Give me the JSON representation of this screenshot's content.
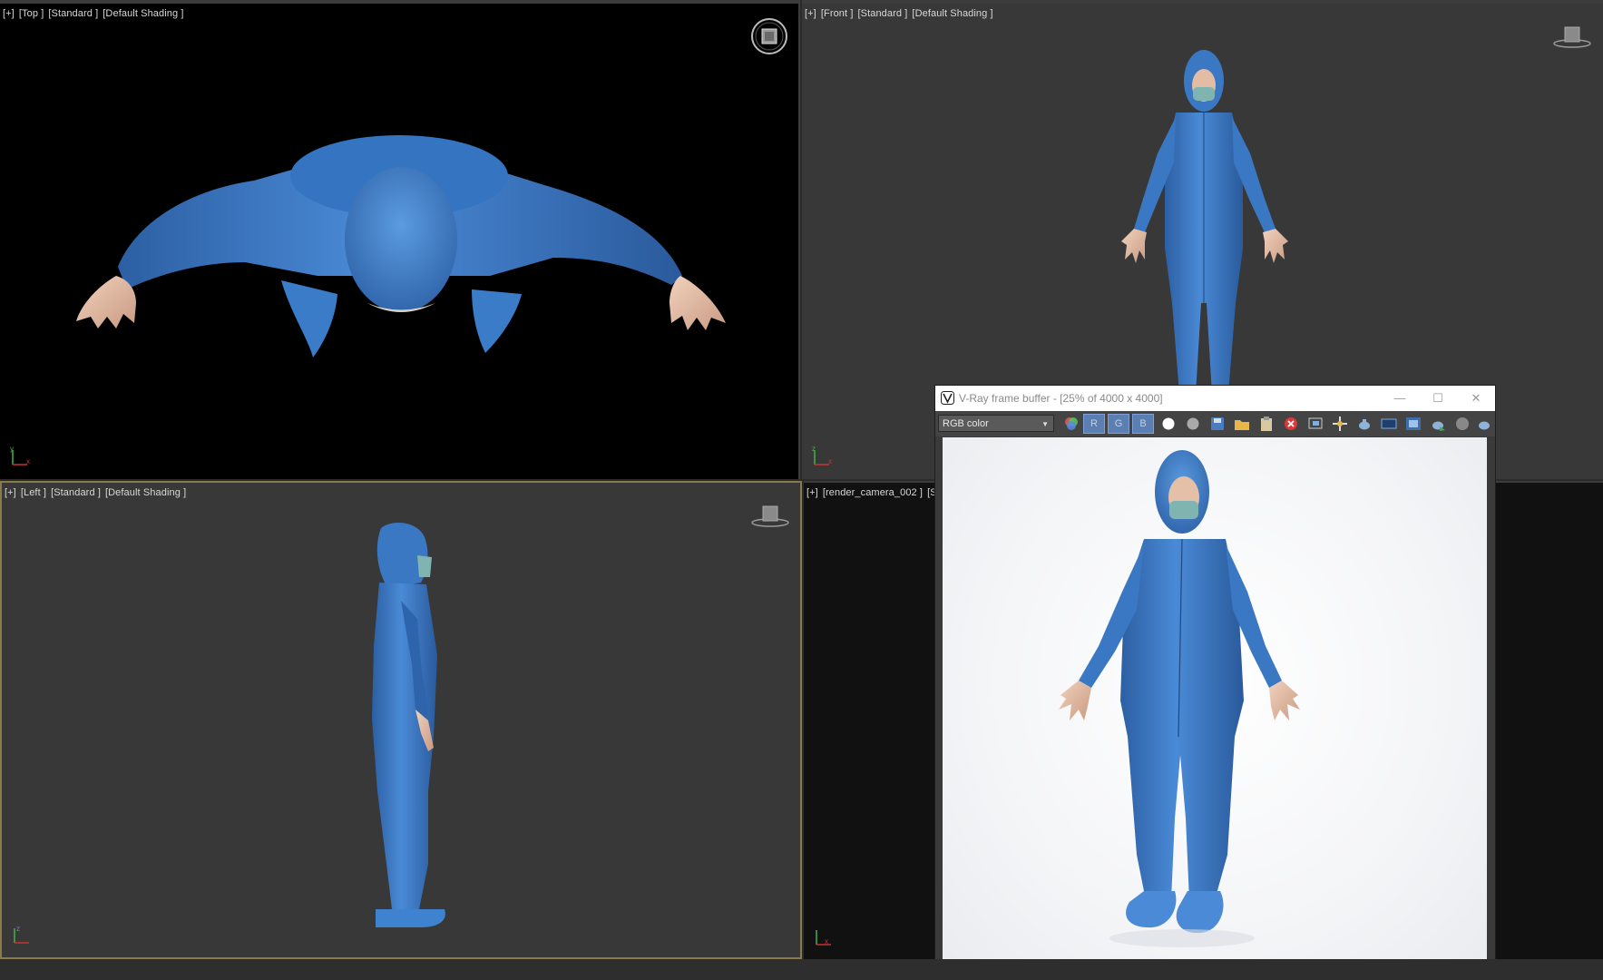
{
  "viewports": {
    "top": {
      "label": [
        "[+]",
        "[Top ]",
        "[Standard ]",
        "[Default Shading ]"
      ]
    },
    "front": {
      "label": [
        "[+]",
        "[Front ]",
        "[Standard ]",
        "[Default Shading ]"
      ]
    },
    "left": {
      "label": [
        "[+]",
        "[Left ]",
        "[Standard ]",
        "[Default Shading ]"
      ]
    },
    "camera": {
      "label": [
        "[+]",
        "[render_camera_002 ]",
        "[Sta"
      ]
    }
  },
  "axis_labels": {
    "x": "x",
    "y": "y",
    "z": "z"
  },
  "vfb": {
    "title": "V-Ray frame buffer - [25% of 4000 x 4000]",
    "window_buttons": {
      "minimize": "—",
      "maximize": "☐",
      "close": "✕"
    },
    "channel": "RGB color",
    "channel_buttons": {
      "r": "R",
      "g": "G",
      "b": "B"
    },
    "toolbar_icons": [
      "color-correct-icon",
      "white-circle-icon",
      "grey-circle-icon",
      "save-icon",
      "open-folder-icon",
      "clipboard-icon",
      "clear-icon",
      "region-render-icon",
      "track-mouse-icon",
      "teapot-icon",
      "pixel-info-icon",
      "lens-effects-icon",
      "render-icon",
      "stop-icon",
      "teapot-interactive-icon"
    ]
  },
  "colors": {
    "suit_blue": "#3f7dc9",
    "viewport_bg": "#383838",
    "top_viewport_bg": "#000000",
    "camera_viewport_bg": "#111111",
    "active_border": "#8a7a4a",
    "vfb_accent": "#5b7fb3"
  }
}
